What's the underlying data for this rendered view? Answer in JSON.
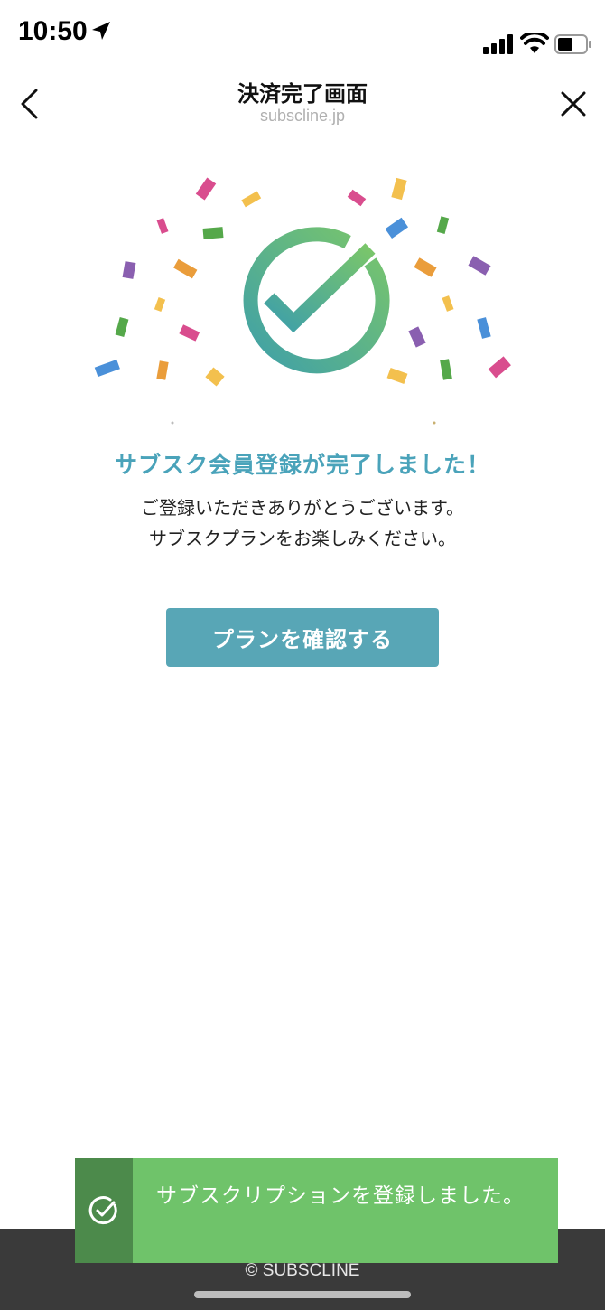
{
  "status_bar": {
    "time": "10:50"
  },
  "header": {
    "title": "決済完了画面",
    "url": "subscline.jp"
  },
  "main": {
    "headline": "サブスク会員登録が完了しました！",
    "message_line1": "ご登録いただきありがとうございます。",
    "message_line2": "サブスクプランをお楽しみください。",
    "cta_label": "プランを確認する"
  },
  "footer": {
    "copyright": "© SUBSCLINE"
  },
  "toast": {
    "message": "サブスクリプションを登録しました。"
  },
  "colors": {
    "accent": "#4aa3ba",
    "button": "#58a6b6",
    "toast": "#6fc36a",
    "toast_icon_bg": "#4c8a4b",
    "footer": "#3a3a3a"
  },
  "icons": {
    "back": "chevron-left-icon",
    "close": "close-icon",
    "hero": "check-circle-icon",
    "toast": "check-circle-icon"
  }
}
